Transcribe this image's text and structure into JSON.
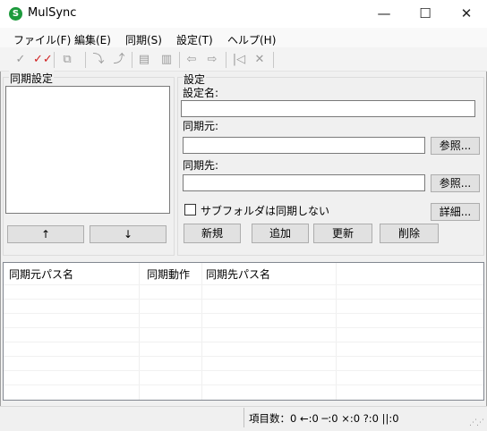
{
  "window": {
    "title": "MulSync",
    "app_icon_letter": "S"
  },
  "window_controls": {
    "minimize": "—",
    "maximize": "☐",
    "close": "✕"
  },
  "menu": [
    "ファイル(F)",
    "編集(E)",
    "同期(S)",
    "設定(T)",
    "ヘルプ(H)"
  ],
  "sync_settings": {
    "legend": "同期設定",
    "up_label": "↑",
    "down_label": "↓"
  },
  "settings": {
    "legend": "設定",
    "name_label": "設定名:",
    "name_value": "",
    "source_label": "同期元:",
    "source_value": "",
    "dest_label": "同期先:",
    "dest_value": "",
    "browse_label": "参照...",
    "checkbox_label": "サブフォルダは同期しない",
    "checkbox_checked": false,
    "details_label": "詳細...",
    "new_label": "新規",
    "add_label": "追加",
    "update_label": "更新",
    "delete_label": "削除"
  },
  "listview": {
    "columns": [
      "同期元パス名",
      "同期動作",
      "同期先パス名"
    ]
  },
  "status": {
    "text": "項目数：0 ←:0 ─:0 ×:0 ?:0 ||:0"
  }
}
